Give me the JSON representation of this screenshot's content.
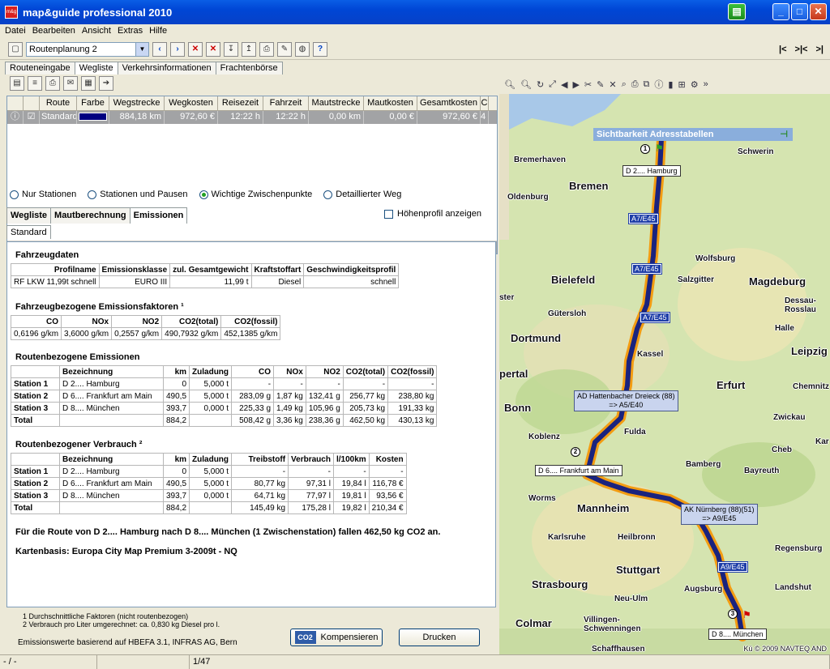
{
  "window": {
    "title": "map&guide professional 2010"
  },
  "menu": [
    "Datei",
    "Bearbeiten",
    "Ansicht",
    "Extras",
    "Hilfe"
  ],
  "toolbar": {
    "route_combo": "Routenplanung 2",
    "nav": [
      "|<",
      ">|<",
      ">|"
    ]
  },
  "main_tabs": [
    "Routeneingabe",
    "Wegliste",
    "Verkehrsinformationen",
    "Frachtenbörse"
  ],
  "grid": {
    "headers": [
      "Route",
      "Farbe",
      "Wegstrecke",
      "Wegkosten",
      "Reisezeit",
      "Fahrzeit",
      "Mautstrecke",
      "Mautkosten",
      "Gesamtkosten",
      "C"
    ],
    "row": [
      "Standard",
      "",
      "884,18 km",
      "972,60 €",
      "12:22 h",
      "12:22 h",
      "0,00 km",
      "0,00 €",
      "972,60 €",
      "4"
    ]
  },
  "radios": [
    "Nur Stationen",
    "Stationen und Pausen",
    "Wichtige Zwischenpunkte",
    "Detaillierter Weg"
  ],
  "sub_tabs": [
    "Wegliste",
    "Mautberechnung",
    "Emissionen"
  ],
  "hoehenprofil": "Höhenprofil anzeigen",
  "standard_tab": "Standard",
  "report": {
    "fahrzeugdaten": {
      "title": "Fahrzeugdaten",
      "headers": [
        "Profilname",
        "Emissionsklasse",
        "zul. Gesamtgewicht",
        "Kraftstoffart",
        "Geschwindigkeitsprofil"
      ],
      "row": [
        "RF LKW 11,99t schnell",
        "EURO III",
        "11,99 t",
        "Diesel",
        "schnell"
      ]
    },
    "faktoren": {
      "title": "Fahrzeugbezogene Emissionsfaktoren ¹",
      "headers": [
        "CO",
        "NOx",
        "NO2",
        "CO2(total)",
        "CO2(fossil)"
      ],
      "row": [
        "0,6196 g/km",
        "3,6000 g/km",
        "0,2557 g/km",
        "490,7932 g/km",
        "452,1385 g/km"
      ]
    },
    "emissionen": {
      "title": "Routenbezogene Emissionen",
      "headers": [
        "",
        "Bezeichnung",
        "km",
        "Zuladung",
        "CO",
        "NOx",
        "NO2",
        "CO2(total)",
        "CO2(fossil)"
      ],
      "rows": [
        [
          "Station 1",
          "D 2.... Hamburg",
          "0",
          "5,000 t",
          "-",
          "-",
          "-",
          "-",
          "-"
        ],
        [
          "Station 2",
          "D 6.... Frankfurt am Main",
          "490,5",
          "5,000 t",
          "283,09 g",
          "1,87 kg",
          "132,41 g",
          "256,77 kg",
          "238,80 kg"
        ],
        [
          "Station 3",
          "D 8.... München",
          "393,7",
          "0,000 t",
          "225,33 g",
          "1,49 kg",
          "105,96 g",
          "205,73 kg",
          "191,33 kg"
        ],
        [
          "Total",
          "",
          "884,2",
          "",
          "508,42 g",
          "3,36 kg",
          "238,36 g",
          "462,50 kg",
          "430,13 kg"
        ]
      ]
    },
    "verbrauch": {
      "title": "Routenbezogener Verbrauch ²",
      "headers": [
        "",
        "Bezeichnung",
        "km",
        "Zuladung",
        "Treibstoff",
        "Verbrauch",
        "l/100km",
        "Kosten"
      ],
      "rows": [
        [
          "Station 1",
          "D 2.... Hamburg",
          "0",
          "5,000 t",
          "-",
          "-",
          "-",
          "-"
        ],
        [
          "Station 2",
          "D 6.... Frankfurt am Main",
          "490,5",
          "5,000 t",
          "80,77 kg",
          "97,31 l",
          "19,84 l",
          "116,78 €"
        ],
        [
          "Station 3",
          "D 8.... München",
          "393,7",
          "0,000 t",
          "64,71 kg",
          "77,97 l",
          "19,81 l",
          "93,56 €"
        ],
        [
          "Total",
          "",
          "884,2",
          "",
          "145,49 kg",
          "175,28 l",
          "19,82 l",
          "210,34 €"
        ]
      ]
    },
    "summary": "Für die Route von D 2.... Hamburg nach D 8.... München (1 Zwischenstation) fallen 462,50 kg CO2 an.",
    "kartenbasis": "Kartenbasis: Europa City Map Premium 3-2009t - NQ"
  },
  "footer": {
    "note1": "1 Durchschnittliche Faktoren (nicht routenbezogen)",
    "note2": "2 Verbrauch pro Liter umgerechnet: ca. 0,830 kg Diesel pro l.",
    "basis": "Emissionswerte basierend auf HBEFA 3.1, INFRAS AG, Bern",
    "co2": "CO2",
    "kompensieren": "Kompensieren",
    "drucken": "Drucken"
  },
  "status": [
    "- / -",
    "",
    "1/47"
  ],
  "map": {
    "popup": "Sichtbarkeit Adresstabellen",
    "cities_big": [
      "Bremen",
      "Bielefeld",
      "Magdeburg",
      "Dortmund",
      "Erfurt",
      "Leipzig",
      "Bonn",
      "Mannheim",
      "Stuttgart",
      "Strasbourg",
      "Colmar"
    ],
    "cities_mid": [
      "Bremerhaven",
      "Schwerin",
      "Oldenburg",
      "Wolfsburg",
      "Salzgitter",
      "Dessau-Rosslau",
      "Gütersloh",
      "Halle",
      "Kassel",
      "Chemnitz",
      "Zwickau",
      "Koblenz",
      "Fulda",
      "Bamberg",
      "Bayreuth",
      "Worms",
      "Karlsruhe",
      "Heilbronn",
      "Regensburg",
      "Augsburg",
      "Landshut",
      "Neu-Ulm",
      "Villingen-Schwenningen",
      "Schaffhausen",
      "Cheb",
      "pertal",
      "ster",
      "Kar"
    ],
    "callouts": {
      "hamburg": "D 2.... Hamburg",
      "frankfurt": "D 6.... Frankfurt am Main",
      "muenchen": "D 8.... München",
      "hattenbach": "AD Hattenbacher Dreieck (88)\n=> A5/E40",
      "nuernberg": "AK Nürnberg (88)(51)\n=> A9/E45"
    },
    "shields": [
      "A7/E45",
      "A7/E45",
      "A7/E45",
      "A9/E45"
    ],
    "copyright": "Kü © 2009 NAVTEQ AND",
    "pins": [
      "1",
      "2",
      "3"
    ]
  }
}
